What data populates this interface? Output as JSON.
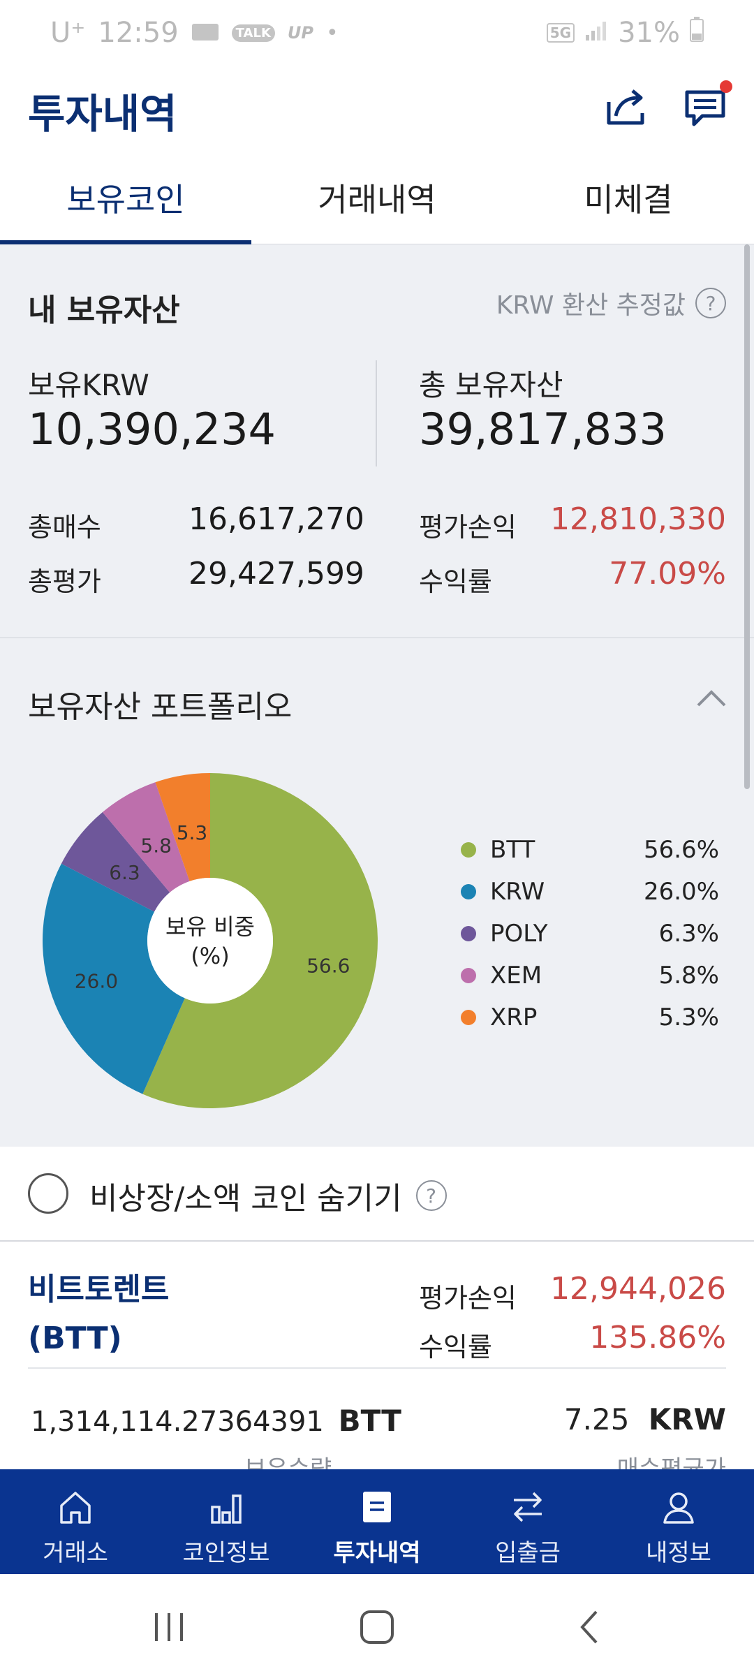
{
  "status_bar": {
    "carrier": "U⁺",
    "time": "12:59",
    "mini_icons": [
      "TALK",
      "UP",
      "•"
    ],
    "network": "5G",
    "battery": "31%"
  },
  "header": {
    "title": "투자내역"
  },
  "tabs": [
    {
      "label": "보유코인"
    },
    {
      "label": "거래내역"
    },
    {
      "label": "미체결"
    }
  ],
  "assets": {
    "title": "내 보유자산",
    "note": "KRW 환산 추정값",
    "help": "?",
    "krw_label": "보유KRW",
    "krw_value": "10,390,234",
    "total_label": "총 보유자산",
    "total_value": "39,817,833",
    "buy_label": "총매수",
    "buy_value": "16,617,270",
    "eval_label": "총평가",
    "eval_value": "29,427,599",
    "pnl_label": "평가손익",
    "pnl_value": "12,810,330",
    "rate_label": "수익률",
    "rate_value": "77.09%"
  },
  "portfolio": {
    "title": "보유자산 포트폴리오",
    "center_line1": "보유 비중",
    "center_line2": "(%)"
  },
  "chart_data": {
    "type": "pie",
    "title": "",
    "center_label": "보유 비중 (%)",
    "categories": [
      "BTT",
      "KRW",
      "POLY",
      "XEM",
      "XRP"
    ],
    "values": [
      56.6,
      26.0,
      6.3,
      5.8,
      5.3
    ],
    "data_labels": [
      "56.6",
      "26.0",
      "6.3",
      "5.8",
      "5.3"
    ],
    "legend_values": [
      "56.6%",
      "26.0%",
      "6.3%",
      "5.8%",
      "5.3%"
    ],
    "colors": [
      "#97b34a",
      "#1b83b4",
      "#6e579a",
      "#bd6fac",
      "#f27f2c"
    ],
    "legend": "right"
  },
  "filter": {
    "label": "비상장/소액 코인 숨기기",
    "help": "?"
  },
  "holding": {
    "name_line1": "비트토렌트",
    "name_line2": "(BTT)",
    "pnl_label": "평가손익",
    "pnl_value": "12,944,026",
    "rate_label": "수익률",
    "rate_value": "135.86%",
    "qty_value": "1,314,114.27364391",
    "qty_unit": "BTT",
    "qty_label": "보유수량",
    "avg_value": "7.25",
    "avg_unit": "KRW",
    "avg_label": "매수평균가"
  },
  "bottom_nav": [
    {
      "label": "거래소",
      "icon": "home-icon"
    },
    {
      "label": "코인정보",
      "icon": "bar-chart-icon"
    },
    {
      "label": "투자내역",
      "icon": "document-icon"
    },
    {
      "label": "입출금",
      "icon": "transfer-icon"
    },
    {
      "label": "내정보",
      "icon": "user-icon"
    }
  ],
  "colors": {
    "brand": "#0b2f72",
    "nav_bg": "#0a3490",
    "gain": "#c94a47"
  }
}
